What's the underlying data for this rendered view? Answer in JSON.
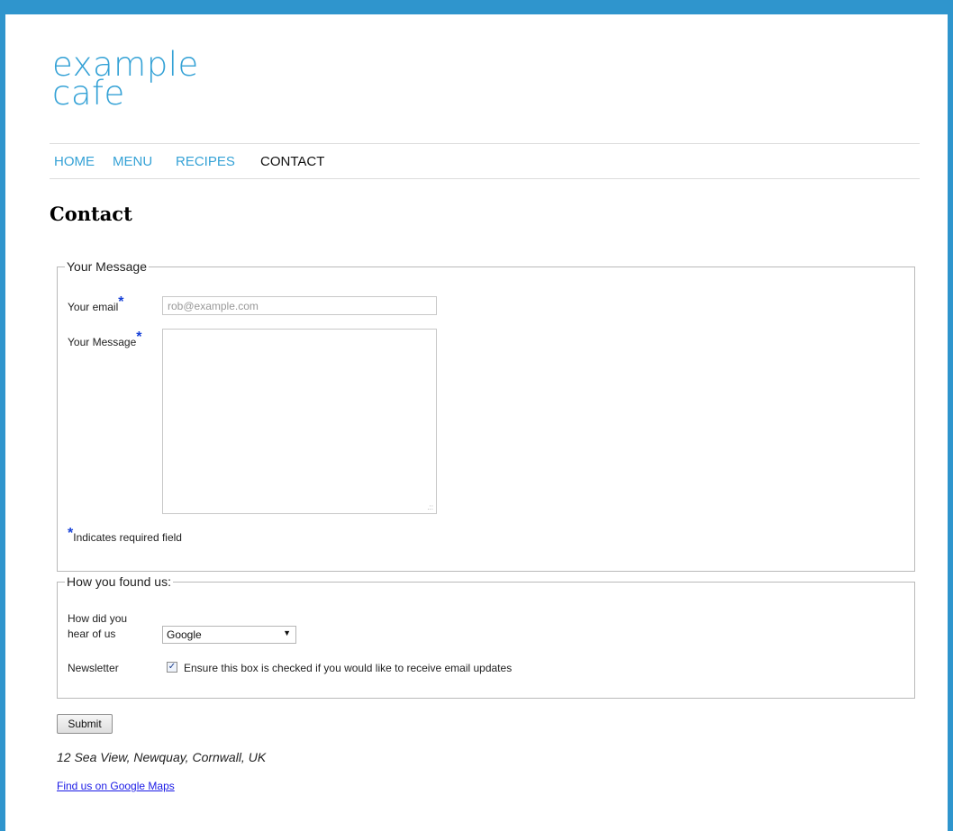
{
  "logo": {
    "line1": "example",
    "line2": "cafe"
  },
  "nav": {
    "items": [
      "HOME",
      "MENU",
      "RECIPES",
      "CONTACT"
    ],
    "active": "CONTACT"
  },
  "page": {
    "title": "Contact"
  },
  "message_section": {
    "legend": "Your Message",
    "email_label": "Your email",
    "email_placeholder": "rob@example.com",
    "message_label": "Your Message",
    "required_star": "*",
    "required_note": "Indicates required field"
  },
  "found_section": {
    "legend": "How you found us:",
    "hear_label": "How did you hear of us",
    "hear_selected": "Google",
    "newsletter_label": "Newsletter",
    "newsletter_checked": true,
    "newsletter_text": "Ensure this box is checked if you would like to receive email updates"
  },
  "form": {
    "submit_label": "Submit"
  },
  "footer": {
    "address": "12 Sea View, Newquay, Cornwall, UK",
    "map_link": "Find us on Google Maps"
  },
  "colors": {
    "accent": "#35a2d6",
    "frame": "#2f95cd",
    "star": "#1640d8",
    "link": "#1a1ae6"
  }
}
